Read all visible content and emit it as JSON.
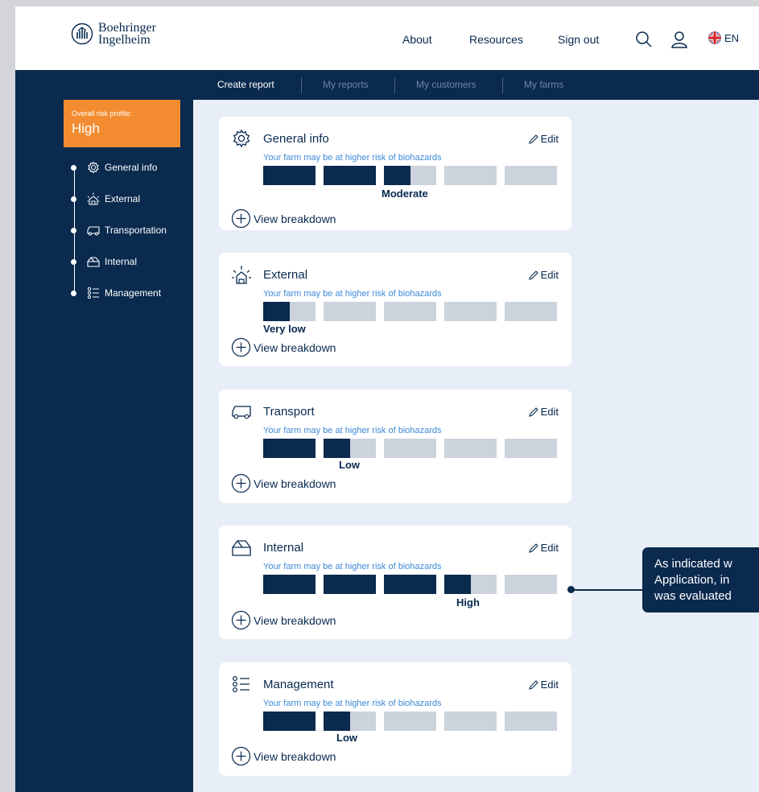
{
  "header": {
    "logo_line1": "Boehringer",
    "logo_line2": "Ingelheim",
    "nav": [
      "About",
      "Resources",
      "Sign out"
    ],
    "language": "EN"
  },
  "subnav": {
    "tabs": [
      {
        "label": "Create report",
        "active": true
      },
      {
        "label": "My reports",
        "active": false
      },
      {
        "label": "My customers",
        "active": false
      },
      {
        "label": "My farms",
        "active": false
      }
    ]
  },
  "sidebar": {
    "risk_label": "Overall risk profile:",
    "risk_value": "High",
    "items": [
      {
        "label": "General info",
        "icon": "gear-icon"
      },
      {
        "label": "External",
        "icon": "barn-sun-icon"
      },
      {
        "label": "Transportation",
        "icon": "truck-icon"
      },
      {
        "label": "Internal",
        "icon": "barn-icon"
      },
      {
        "label": "Management",
        "icon": "list-icon"
      }
    ]
  },
  "cards": [
    {
      "title": "General info",
      "icon": "gear-icon",
      "edit": "Edit",
      "note": "Your farm may be at higher risk of biohazards",
      "level": "Moderate",
      "level_fraction": 2.5,
      "breakdown": "View breakdown"
    },
    {
      "title": "External",
      "icon": "barn-sun-icon",
      "edit": "Edit",
      "note": "Your farm may be at higher risk of biohazards",
      "level": "Very low",
      "level_fraction": 0.5,
      "breakdown": "View breakdown"
    },
    {
      "title": "Transport",
      "icon": "truck-icon",
      "edit": "Edit",
      "note": "Your farm may be at higher risk of biohazards",
      "level": "Low",
      "level_fraction": 1.5,
      "breakdown": "View breakdown"
    },
    {
      "title": "Internal",
      "icon": "barn-icon",
      "edit": "Edit",
      "note": "Your farm may be at higher risk of biohazards",
      "level": "High",
      "level_fraction": 3.5,
      "breakdown": "View breakdown"
    },
    {
      "title": "Management",
      "icon": "list-icon",
      "edit": "Edit",
      "note": "Your farm may be at higher risk of biohazards",
      "level": "Low",
      "level_fraction": 1.5,
      "breakdown": "View breakdown"
    }
  ],
  "callout": {
    "lines": [
      "As indicated w",
      "Application, in",
      "was evaluated"
    ]
  },
  "colors": {
    "navy": "#0a2a4e",
    "accent_orange": "#f38c30",
    "note_blue": "#3d8ad6",
    "bar_empty": "#ccd3dc"
  }
}
